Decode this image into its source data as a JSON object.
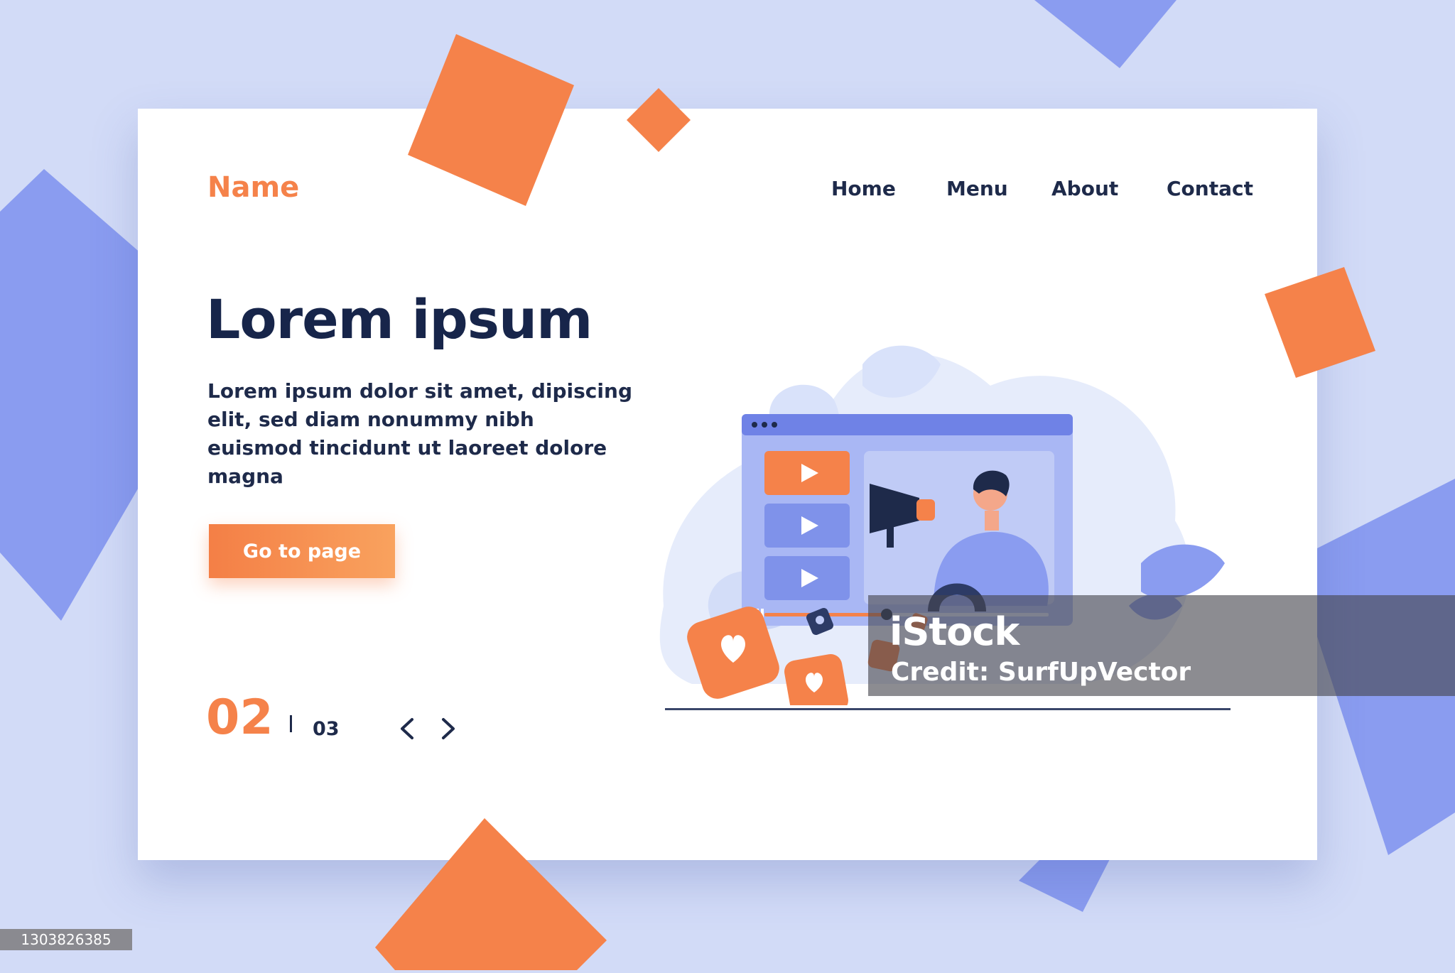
{
  "colors": {
    "accent": "#f5824a",
    "background": "#d2dbf7",
    "shape_blue": "#8a9cf0",
    "text_dark": "#1e2a4a",
    "card": "#ffffff"
  },
  "header": {
    "brand": "Name",
    "nav": [
      "Home",
      "Menu",
      "About",
      "Contact"
    ]
  },
  "hero": {
    "title": "Lorem ipsum",
    "body": "Lorem ipsum dolor sit amet, dipiscing elit, sed diam nonummy nibh euismod tincidunt ut laoreet dolore magna",
    "cta": "Go to page"
  },
  "pagination": {
    "current": "02",
    "total": "03",
    "prev_icon": "chevron-left-icon",
    "next_icon": "chevron-right-icon"
  },
  "illustration": {
    "video_items": 3,
    "icons": [
      "play-icon",
      "megaphone-icon",
      "heart-icon"
    ]
  },
  "watermark": {
    "logo": "iStock",
    "credit": "Credit: SurfUpVector"
  },
  "image_id": "1303826385"
}
